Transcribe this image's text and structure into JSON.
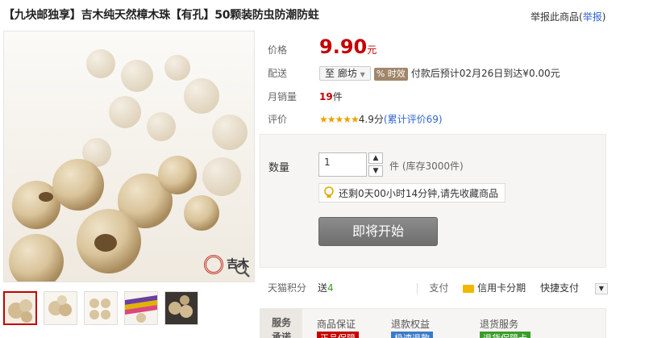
{
  "title": "【九块邮独享】吉木纯天然樟木珠【有孔】50颗装防虫防潮防蛀",
  "report": {
    "text": "举报此商品",
    "link": "举报"
  },
  "brand_logo_text": "吉木",
  "price": {
    "label": "价格",
    "value": "9.90",
    "unit": "元"
  },
  "delivery": {
    "label": "配送",
    "location": "至 廊坊",
    "badge": "时效",
    "note": "付款后预计02月26日到达¥0.00元"
  },
  "monthly_sales": {
    "label": "月销量",
    "value": "19",
    "unit": "件"
  },
  "rating": {
    "label": "评价",
    "stars": "★★★★★",
    "score": "4.9分",
    "count_text": "(累计评价69)"
  },
  "quantity": {
    "label": "数量",
    "value": "1",
    "stock": "件 (库存3000件)",
    "up": "▲",
    "down": "▼"
  },
  "reminder": "还剩0天00小时14分钟,请先收藏商品",
  "start_button": "即将开始",
  "points": {
    "label": "天猫积分",
    "text": "送",
    "value": "4"
  },
  "pay": {
    "label": "支付",
    "option": "信用卡分期",
    "option2": "快捷支付"
  },
  "service": {
    "heading1": "服务",
    "heading2": "承诺",
    "cols": [
      {
        "title": "商品保证",
        "badge": "正品保障"
      },
      {
        "title": "退款权益",
        "badge": "极速退款"
      },
      {
        "title": "退货服务",
        "badge": "退货保障卡"
      }
    ]
  },
  "colors": {
    "price_red": "#c40000",
    "link_blue": "#3366cc",
    "points_green": "#3a9c2a",
    "button_gray": "#7a7a7a"
  }
}
